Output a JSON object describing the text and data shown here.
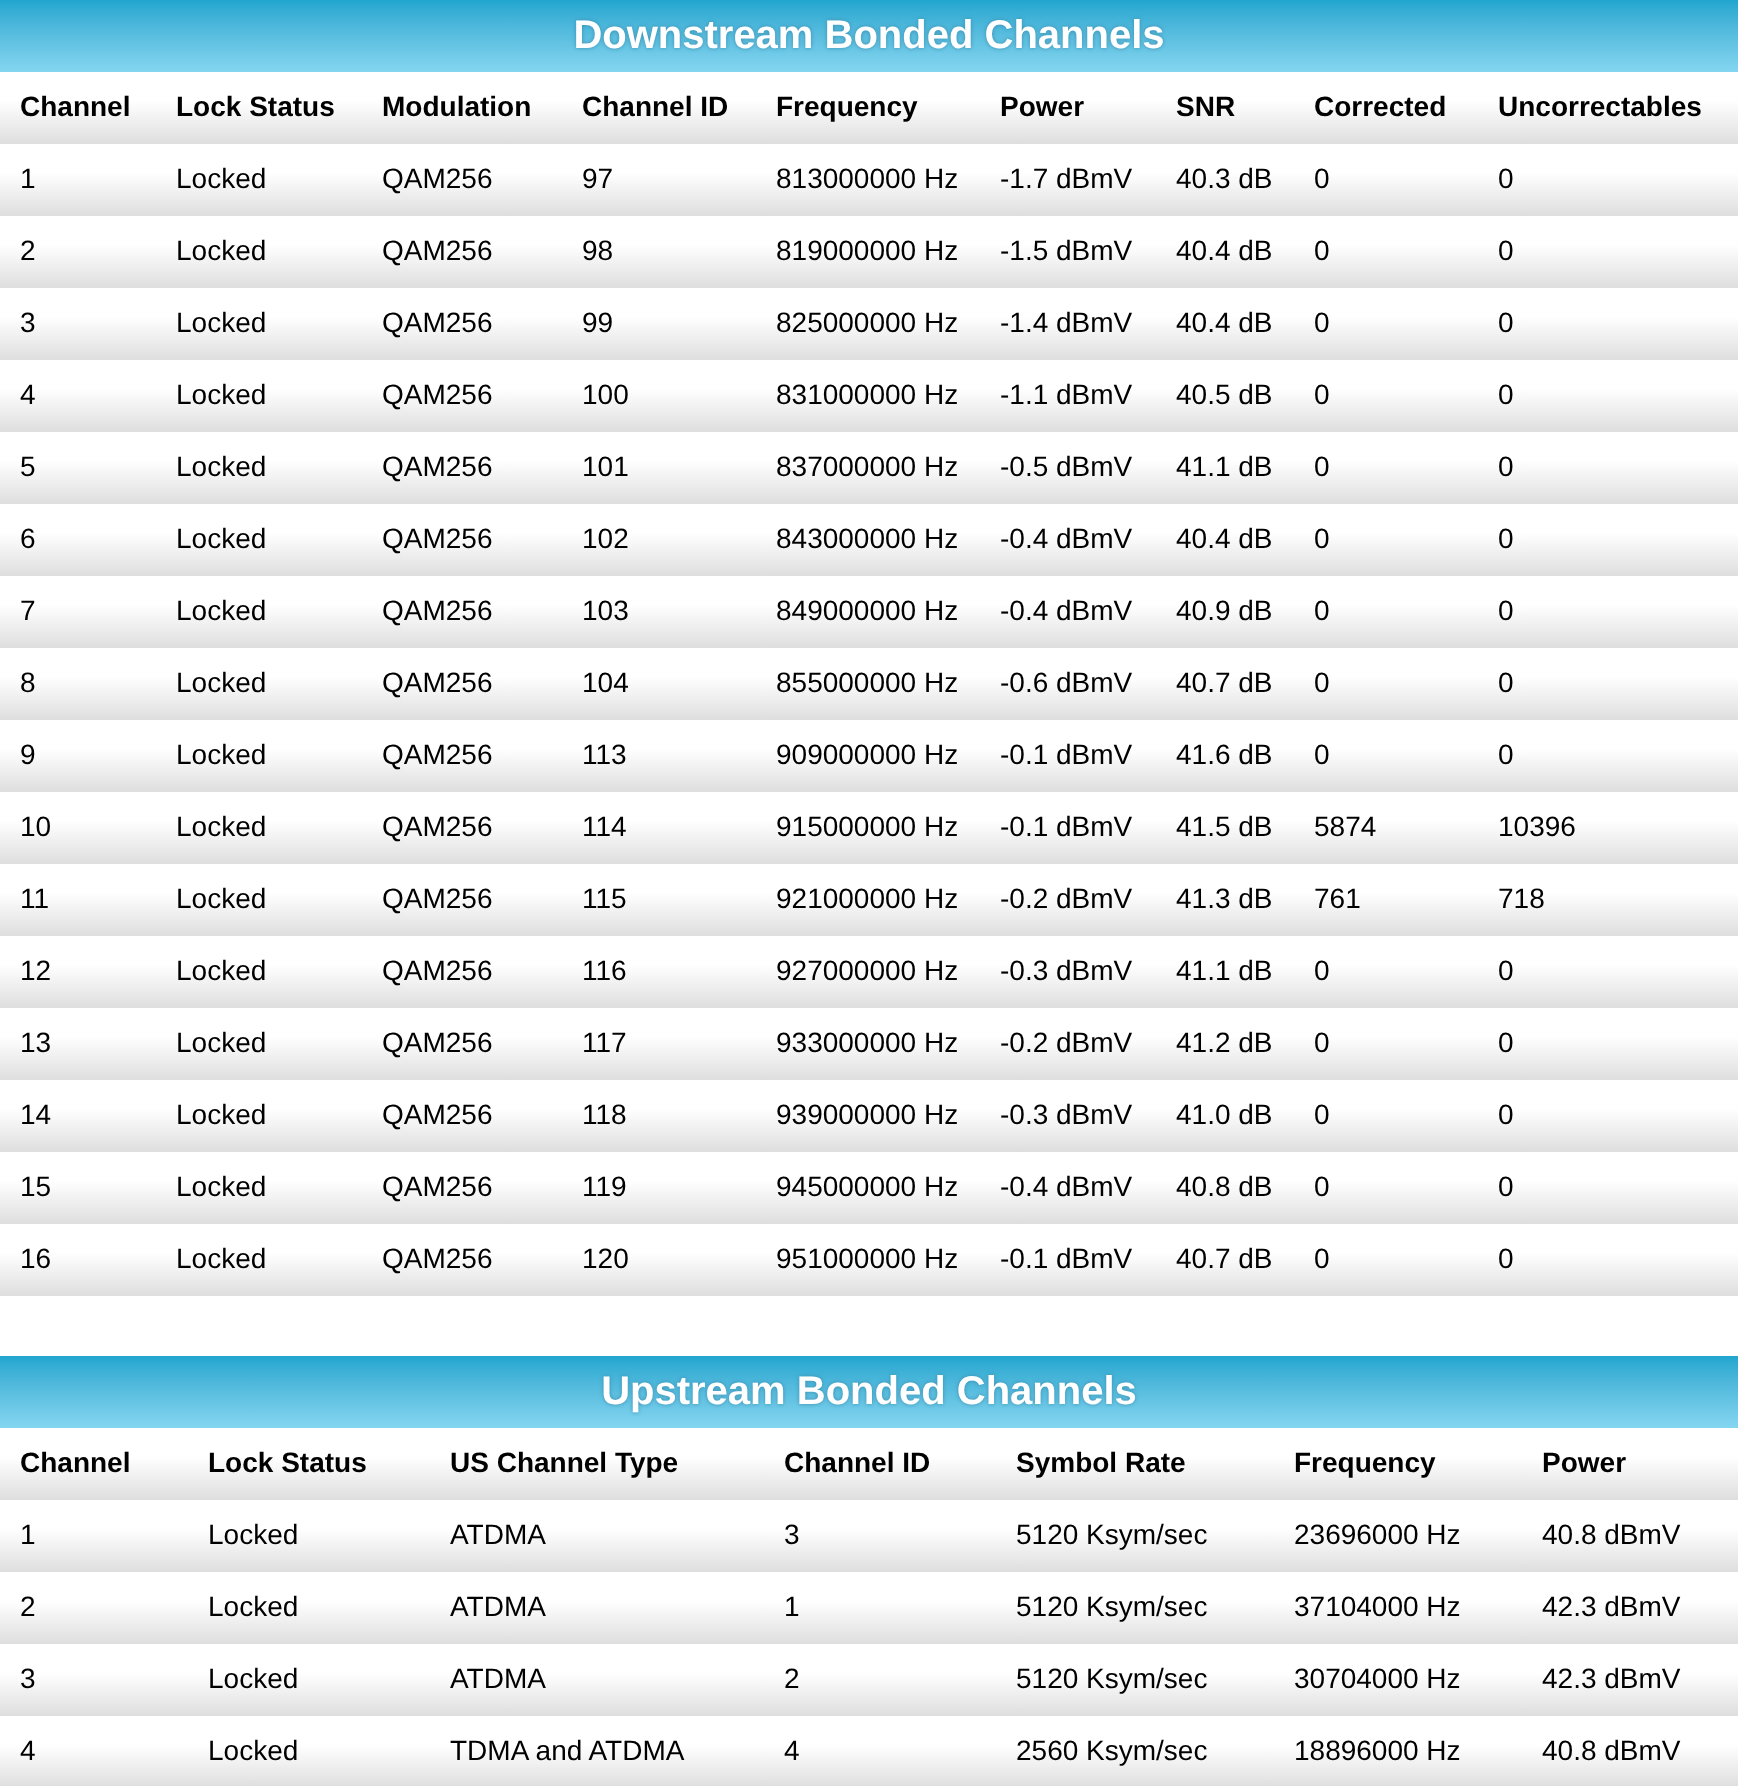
{
  "sections": [
    {
      "title": "Downstream Bonded Channels",
      "columns": [
        "Channel",
        "Lock Status",
        "Modulation",
        "Channel ID",
        "Frequency",
        "Power",
        "SNR",
        "Corrected",
        "Uncorrectables"
      ],
      "rows": [
        [
          "1",
          "Locked",
          "QAM256",
          "97",
          "813000000 Hz",
          "-1.7 dBmV",
          "40.3 dB",
          "0",
          "0"
        ],
        [
          "2",
          "Locked",
          "QAM256",
          "98",
          "819000000 Hz",
          "-1.5 dBmV",
          "40.4 dB",
          "0",
          "0"
        ],
        [
          "3",
          "Locked",
          "QAM256",
          "99",
          "825000000 Hz",
          "-1.4 dBmV",
          "40.4 dB",
          "0",
          "0"
        ],
        [
          "4",
          "Locked",
          "QAM256",
          "100",
          "831000000 Hz",
          "-1.1 dBmV",
          "40.5 dB",
          "0",
          "0"
        ],
        [
          "5",
          "Locked",
          "QAM256",
          "101",
          "837000000 Hz",
          "-0.5 dBmV",
          "41.1 dB",
          "0",
          "0"
        ],
        [
          "6",
          "Locked",
          "QAM256",
          "102",
          "843000000 Hz",
          "-0.4 dBmV",
          "40.4 dB",
          "0",
          "0"
        ],
        [
          "7",
          "Locked",
          "QAM256",
          "103",
          "849000000 Hz",
          "-0.4 dBmV",
          "40.9 dB",
          "0",
          "0"
        ],
        [
          "8",
          "Locked",
          "QAM256",
          "104",
          "855000000 Hz",
          "-0.6 dBmV",
          "40.7 dB",
          "0",
          "0"
        ],
        [
          "9",
          "Locked",
          "QAM256",
          "113",
          "909000000 Hz",
          "-0.1 dBmV",
          "41.6 dB",
          "0",
          "0"
        ],
        [
          "10",
          "Locked",
          "QAM256",
          "114",
          "915000000 Hz",
          "-0.1 dBmV",
          "41.5 dB",
          "5874",
          "10396"
        ],
        [
          "11",
          "Locked",
          "QAM256",
          "115",
          "921000000 Hz",
          "-0.2 dBmV",
          "41.3 dB",
          "761",
          "718"
        ],
        [
          "12",
          "Locked",
          "QAM256",
          "116",
          "927000000 Hz",
          "-0.3 dBmV",
          "41.1 dB",
          "0",
          "0"
        ],
        [
          "13",
          "Locked",
          "QAM256",
          "117",
          "933000000 Hz",
          "-0.2 dBmV",
          "41.2 dB",
          "0",
          "0"
        ],
        [
          "14",
          "Locked",
          "QAM256",
          "118",
          "939000000 Hz",
          "-0.3 dBmV",
          "41.0 dB",
          "0",
          "0"
        ],
        [
          "15",
          "Locked",
          "QAM256",
          "119",
          "945000000 Hz",
          "-0.4 dBmV",
          "40.8 dB",
          "0",
          "0"
        ],
        [
          "16",
          "Locked",
          "QAM256",
          "120",
          "951000000 Hz",
          "-0.1 dBmV",
          "40.7 dB",
          "0",
          "0"
        ]
      ]
    },
    {
      "title": "Upstream Bonded Channels",
      "columns": [
        "Channel",
        "Lock Status",
        "US Channel Type",
        "Channel ID",
        "Symbol Rate",
        "Frequency",
        "Power"
      ],
      "rows": [
        [
          "1",
          "Locked",
          "ATDMA",
          "3",
          "5120 Ksym/sec",
          "23696000 Hz",
          "40.8 dBmV"
        ],
        [
          "2",
          "Locked",
          "ATDMA",
          "1",
          "5120 Ksym/sec",
          "37104000 Hz",
          "42.3 dBmV"
        ],
        [
          "3",
          "Locked",
          "ATDMA",
          "2",
          "5120 Ksym/sec",
          "30704000 Hz",
          "42.3 dBmV"
        ],
        [
          "4",
          "Locked",
          "TDMA and ATDMA",
          "4",
          "2560 Ksym/sec",
          "18896000 Hz",
          "40.8 dBmV"
        ]
      ]
    }
  ]
}
